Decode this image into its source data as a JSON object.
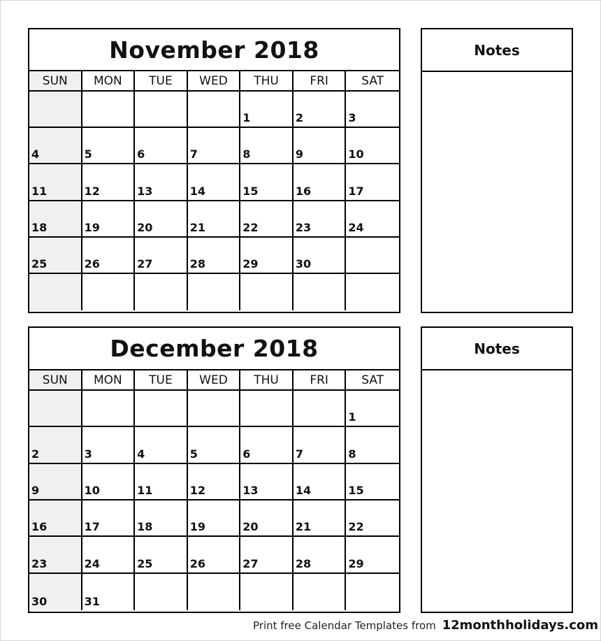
{
  "weekdays": [
    "SUN",
    "MON",
    "TUE",
    "WED",
    "THU",
    "FRI",
    "SAT"
  ],
  "colors": {
    "sunday_fill": "#f0f0f0",
    "border": "#000000"
  },
  "calendars": [
    {
      "title": "November 2018",
      "weeks": [
        [
          "",
          "",
          "",
          "",
          "1",
          "2",
          "3"
        ],
        [
          "4",
          "5",
          "6",
          "7",
          "8",
          "9",
          "10"
        ],
        [
          "11",
          "12",
          "13",
          "14",
          "15",
          "16",
          "17"
        ],
        [
          "18",
          "19",
          "20",
          "21",
          "22",
          "23",
          "24"
        ],
        [
          "25",
          "26",
          "27",
          "28",
          "29",
          "30",
          ""
        ],
        [
          "",
          "",
          "",
          "",
          "",
          "",
          ""
        ]
      ],
      "notes_label": "Notes"
    },
    {
      "title": "December 2018",
      "weeks": [
        [
          "",
          "",
          "",
          "",
          "",
          "",
          "1"
        ],
        [
          "2",
          "3",
          "4",
          "5",
          "6",
          "7",
          "8"
        ],
        [
          "9",
          "10",
          "11",
          "12",
          "13",
          "14",
          "15"
        ],
        [
          "16",
          "17",
          "18",
          "19",
          "20",
          "21",
          "22"
        ],
        [
          "23",
          "24",
          "25",
          "26",
          "27",
          "28",
          "29"
        ],
        [
          "30",
          "31",
          "",
          "",
          "",
          "",
          ""
        ]
      ],
      "notes_label": "Notes"
    }
  ],
  "footer": {
    "text": "Print free Calendar Templates from",
    "site": "12monthholidays.com"
  }
}
